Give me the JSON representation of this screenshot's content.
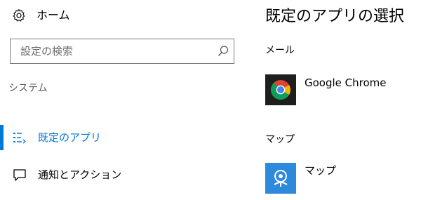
{
  "nav": {
    "home_label": "ホーム",
    "search_placeholder": "設定の検索",
    "section_heading": "システム",
    "items": [
      {
        "label": "既定のアプリ",
        "active": true,
        "icon": "default-apps-icon"
      },
      {
        "label": "通知とアクション",
        "active": false,
        "icon": "notifications-icon"
      }
    ]
  },
  "main": {
    "title": "既定のアプリの選択",
    "groups": [
      {
        "label": "メール",
        "app_name": "Google Chrome",
        "icon": "google-chrome-icon"
      },
      {
        "label": "マップ",
        "app_name": "マップ",
        "icon": "maps-app-icon"
      }
    ]
  },
  "colors": {
    "accent": "#0078d7",
    "chrome_tile": "#1e1e1e",
    "maps_tile": "#2d89dc"
  }
}
